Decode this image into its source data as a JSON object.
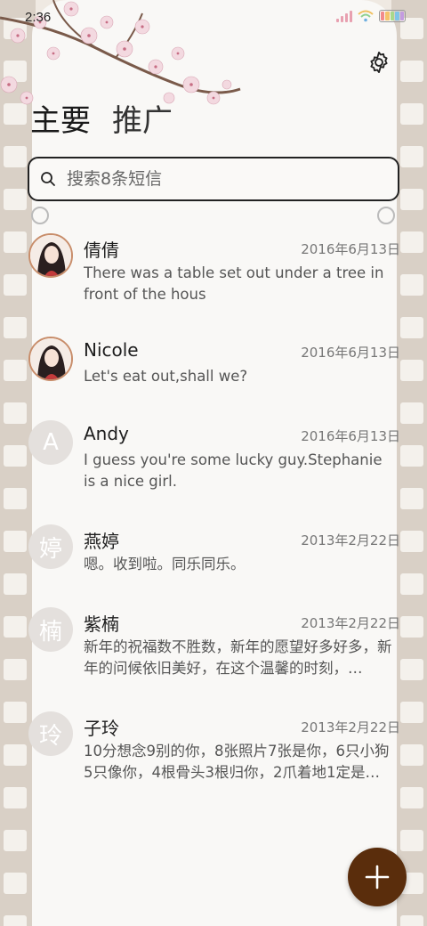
{
  "status_bar": {
    "time": "2:36"
  },
  "header": {
    "tabs": [
      {
        "label": "主要",
        "active": true
      },
      {
        "label": "推广",
        "active": false
      }
    ]
  },
  "search": {
    "placeholder": "搜索8条短信"
  },
  "messages": [
    {
      "name": "倩倩",
      "date": "2016年6月13日",
      "preview": "There was a table set out under a tree in front of the hous",
      "avatar_type": "photo",
      "avatar_letter": ""
    },
    {
      "name": "Nicole",
      "date": "2016年6月13日",
      "preview": "Let's eat out,shall we?",
      "avatar_type": "photo",
      "avatar_letter": ""
    },
    {
      "name": "Andy",
      "date": "2016年6月13日",
      "preview": "I guess you're some lucky guy.Stephanie is a nice girl.",
      "avatar_type": "letter",
      "avatar_letter": "A"
    },
    {
      "name": "燕婷",
      "date": "2013年2月22日",
      "preview": "嗯。收到啦。同乐同乐。",
      "avatar_type": "letter",
      "avatar_letter": "婷"
    },
    {
      "name": "紫楠",
      "date": "2013年2月22日",
      "preview": "新年的祝福数不胜数，新年的愿望好多好多，新年的问候依旧美好，在这个温馨的时刻，…",
      "avatar_type": "letter",
      "avatar_letter": "楠"
    },
    {
      "name": "子玲",
      "date": "2013年2月22日",
      "preview": "10分想念9别的你，8张照片7张是你，6只小狗5只像你，4根骨头3根归你，2爪着地1定是…",
      "avatar_type": "letter",
      "avatar_letter": "玲"
    }
  ],
  "colors": {
    "fab": "#5a2d0c",
    "accent_avatar_border": "#c88d6a",
    "film": "#d9d0c6"
  },
  "icons": {
    "settings": "gear-icon",
    "search": "search-icon",
    "compose": "plus-icon"
  }
}
